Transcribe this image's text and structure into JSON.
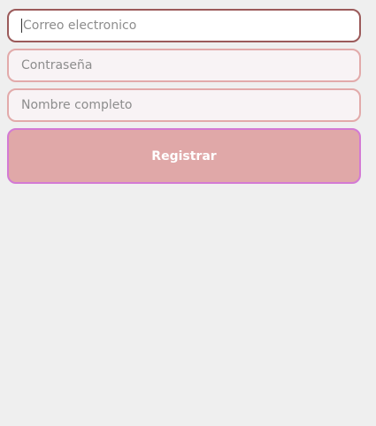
{
  "form": {
    "email": {
      "value": "",
      "placeholder": "Correo electronico"
    },
    "password": {
      "value": "",
      "placeholder": "Contraseña"
    },
    "full_name": {
      "value": "",
      "placeholder": "Nombre completo"
    },
    "submit_label": "Registrar"
  },
  "colors": {
    "page_background": "#efefef",
    "field_border": "#e2aaaa",
    "field_border_focused": "#9b5a5a",
    "field_background": "#f8f3f5",
    "button_background": "#e0a8a8",
    "button_border": "#d37ad4",
    "button_text": "#ffffff"
  }
}
